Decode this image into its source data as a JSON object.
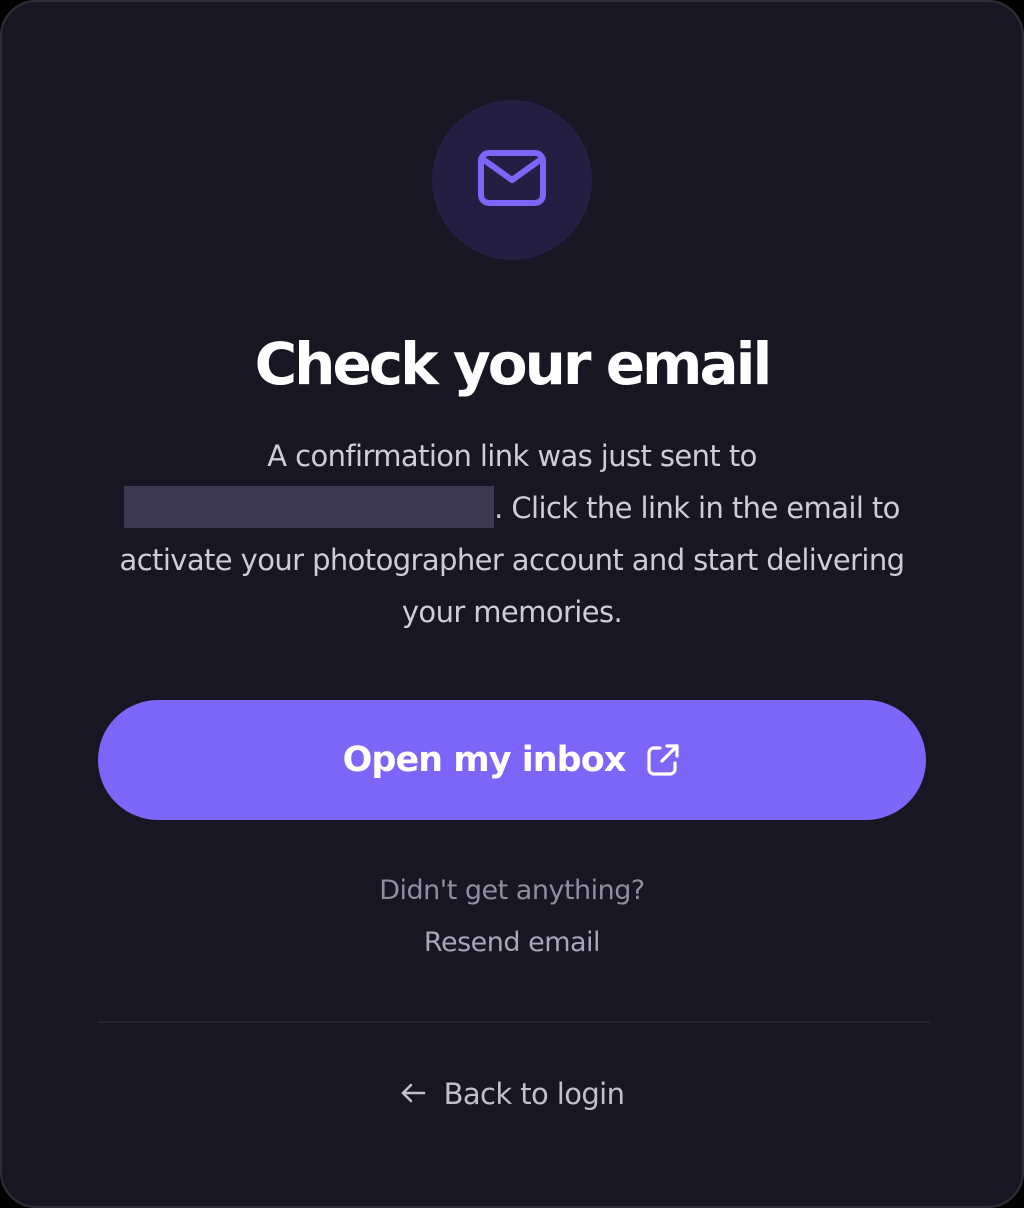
{
  "header": {
    "icon": "mail-icon",
    "title": "Check your email"
  },
  "message": {
    "line_start": "A confirmation link was just sent to",
    "line_end": ". Click the link in the email to activate your photographer account and start delivering your memories."
  },
  "primary_action": {
    "label": "Open my inbox",
    "icon": "external-link-icon"
  },
  "resend": {
    "prompt": "Didn't get anything?",
    "link_label": "Resend email"
  },
  "footer": {
    "back_label": "Back to login",
    "icon": "arrow-left-icon"
  },
  "colors": {
    "background": "#181623",
    "accent": "#7c66f7",
    "icon_circle": "#241e43",
    "redaction": "#3b3850"
  }
}
